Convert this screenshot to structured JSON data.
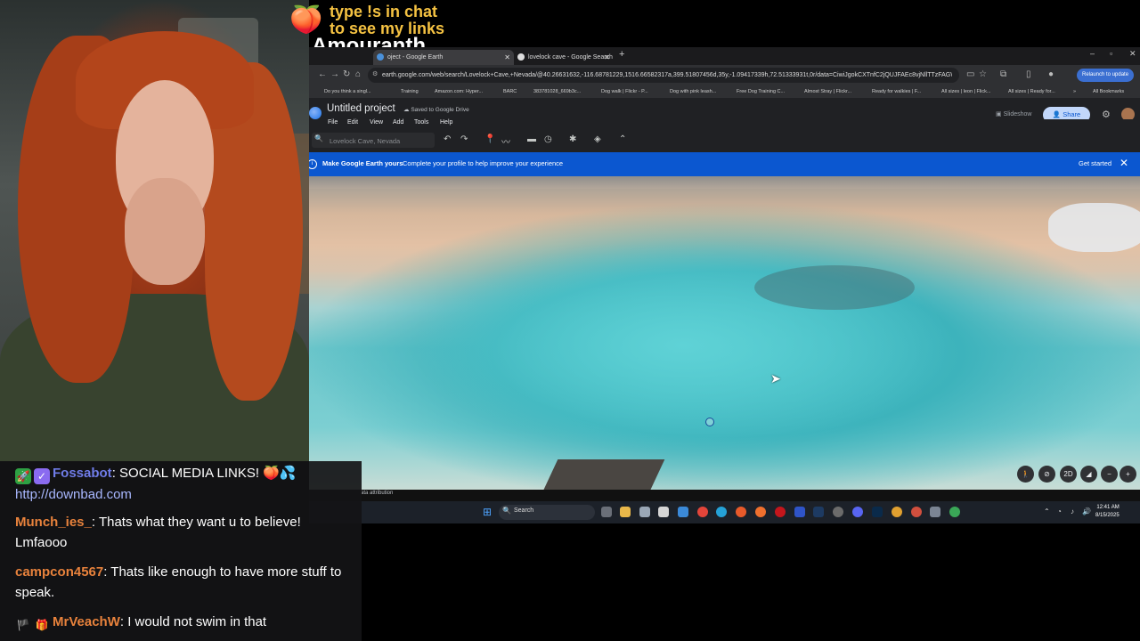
{
  "overlay": {
    "promo_line1": "type !s in chat",
    "promo_line2": "to see my links",
    "streamer_name": "Amouranth"
  },
  "browser": {
    "tabs": [
      {
        "label": "oject - Google Earth",
        "active": true
      },
      {
        "label": "lovelock cave - Google Search",
        "active": false
      }
    ],
    "new_tab": "+",
    "window_controls": [
      "–",
      "▫",
      "✕"
    ],
    "url": "earth.google.com/web/search/Lovelock+Cave,+Nevada/@40.26631632,-116.68781229,1516.66582317a,399.51807456d,35y,-1.09417339h,72.51333931t,0r/data=CiwiJgokCXTnfC2jQUJFAEc8vjNllTTzFAGWSEdE74V...",
    "relaunch": "Relaunch to update",
    "bookmarks": [
      "Do you think a singl...",
      "Training",
      "Amazon.com: Hyper...",
      "BARC",
      "383781028_669b3c...",
      "Dog walk | Flickr - P...",
      "Dog with pink leash...",
      "Free Dog Training C...",
      "Almost Stray | Flickr...",
      "Ready for walkies | F...",
      "All sizes | leon | Flick...",
      "All sizes | Ready for...",
      "»",
      "All Bookmarks"
    ]
  },
  "earth": {
    "project_title": "Untitled project",
    "saved_status": "Saved to Google Drive",
    "menu": [
      "File",
      "Edit",
      "View",
      "Add",
      "Tools",
      "Help"
    ],
    "slideshow": "Slideshow",
    "share": "Share",
    "search_placeholder": "Lovelock Cave, Nevada",
    "banner": {
      "title": "Make Google Earth yours",
      "subtitle": "Complete your profile to help improve your experience",
      "action": "Get started"
    },
    "view_controls": [
      "2D"
    ],
    "attribution": "ata attribution"
  },
  "taskbar": {
    "search_label": "Search",
    "time": "12:41 AM",
    "date": "8/15/2025"
  },
  "chat": [
    {
      "user": "Fossabot",
      "user_color": "#6f7ce8",
      "message": ": SOCIAL MEDIA LINKS! 🍑💦",
      "link": "http://downbad.com"
    },
    {
      "user": "Munch_ies_",
      "user_color": "#e8823c",
      "message": ": Thats what they want u to believe! Lmfaooo"
    },
    {
      "user": "campcon4567",
      "user_color": "#e8823c",
      "message": ": Thats like enough to have more stuff to speak."
    },
    {
      "user": "MrVeachW",
      "user_color": "#e8823c",
      "message": ": I would not swim in that"
    }
  ],
  "colors": {
    "promo": "#f5c242",
    "banner": "#0b57d0",
    "share_bg": "#c2d7fa"
  }
}
